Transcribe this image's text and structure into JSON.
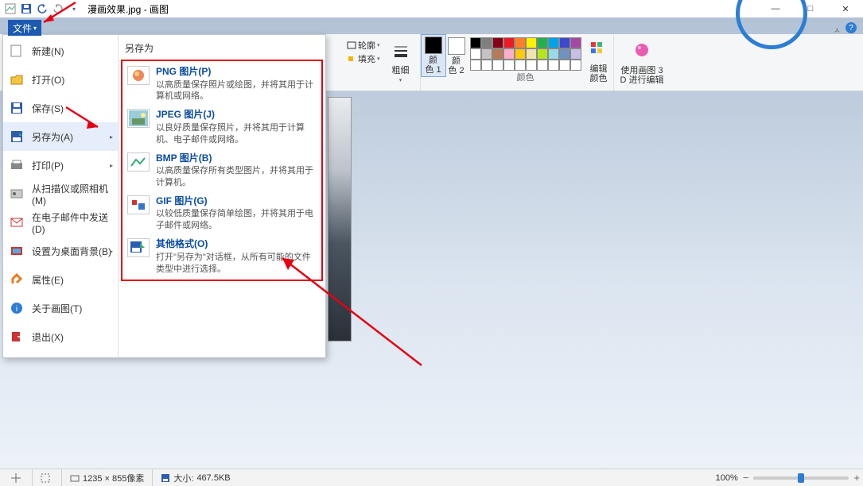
{
  "title_bar": {
    "filename": "漫画效果.jpg",
    "app_name": "画图"
  },
  "window_controls": {
    "min": "—",
    "max": "□",
    "close": "✕"
  },
  "file_tab": {
    "label": "文件"
  },
  "ribbon": {
    "outline_label": "轮廓",
    "fill_label": "填充",
    "thickness_label": "粗细",
    "color1_label": "颜\n色 1",
    "color2_label": "颜\n色 2",
    "edit_colors_label": "编辑\n颜色",
    "paint3d_label": "使用画图 3\nD 进行编辑",
    "group_colors": "颜色"
  },
  "file_menu": {
    "items": [
      {
        "label": "新建(N)"
      },
      {
        "label": "打开(O)"
      },
      {
        "label": "保存(S)"
      },
      {
        "label": "另存为(A)",
        "has_sub": true
      },
      {
        "label": "打印(P)",
        "has_sub": true
      },
      {
        "label": "从扫描仪或照相机(M)"
      },
      {
        "label": "在电子邮件中发送(D)"
      },
      {
        "label": "设置为桌面背景(B)",
        "has_sub": true
      },
      {
        "label": "属性(E)"
      },
      {
        "label": "关于画图(T)"
      },
      {
        "label": "退出(X)"
      }
    ],
    "sub_header": "另存为",
    "sub_items": [
      {
        "title": "PNG 图片(P)",
        "desc": "以高质量保存照片或绘图，并将其用于计算机或网络。"
      },
      {
        "title": "JPEG 图片(J)",
        "desc": "以良好质量保存照片，并将其用于计算机、电子邮件或网络。"
      },
      {
        "title": "BMP 图片(B)",
        "desc": "以高质量保存所有类型图片，并将其用于计算机。"
      },
      {
        "title": "GIF 图片(G)",
        "desc": "以较低质量保存简单绘图，并将其用于电子邮件或网络。"
      },
      {
        "title": "其他格式(O)",
        "desc": "打开\"另存为\"对话框，从所有可能的文件类型中进行选择。"
      }
    ]
  },
  "statusbar": {
    "dimensions": "1235 × 855像素",
    "size_label": "大小:",
    "size_value": "467.5KB",
    "zoom": "100%"
  },
  "palette_colors": [
    "#000000",
    "#7f7f7f",
    "#880015",
    "#ed1c24",
    "#ff7f27",
    "#fff200",
    "#22b14c",
    "#00a2e8",
    "#3f48cc",
    "#a349a4",
    "#ffffff",
    "#c3c3c3",
    "#b97a57",
    "#ffaec9",
    "#ffc90e",
    "#efe4b0",
    "#b5e61d",
    "#99d9ea",
    "#7092be",
    "#c8bfe7",
    "#ffffff",
    "#ffffff",
    "#ffffff",
    "#ffffff",
    "#ffffff",
    "#ffffff",
    "#ffffff",
    "#ffffff",
    "#ffffff",
    "#ffffff"
  ]
}
